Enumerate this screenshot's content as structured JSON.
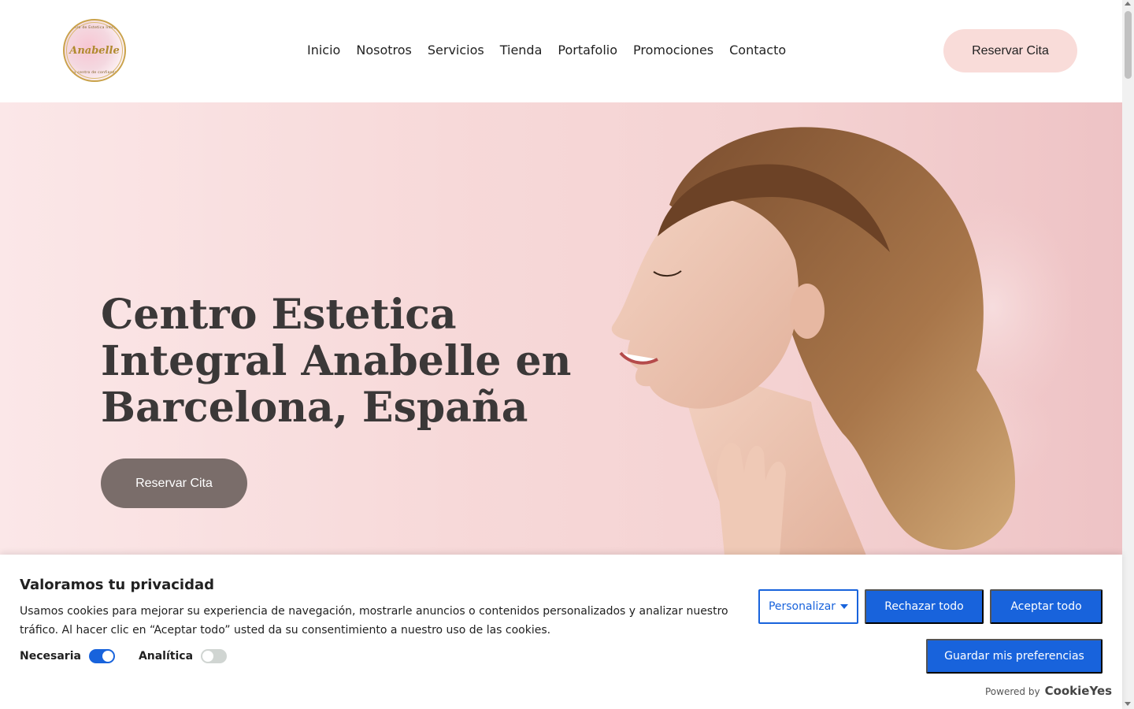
{
  "header": {
    "logo_top_text": "Centro de Estetica Integral",
    "logo_text": "Anabelle",
    "logo_bottom_text": "tu centro de confianza",
    "nav": [
      "Inicio",
      "Nosotros",
      "Servicios",
      "Tienda",
      "Portafolio",
      "Promociones",
      "Contacto"
    ],
    "cta": "Reservar Cita"
  },
  "hero": {
    "title_bold": "Centro Estetica Integral Anabelle",
    "title_rest": " en Barcelona, España",
    "cta": "Reservar Cita"
  },
  "cookie": {
    "title": "Valoramos tu privacidad",
    "description": "Usamos cookies para mejorar su experiencia de navegación, mostrarle anuncios o contenidos personalizados y analizar nuestro tráfico. Al hacer clic en “Aceptar todo” usted da su consentimiento a nuestro uso de las cookies.",
    "toggles": [
      {
        "label": "Necesaria",
        "on": true
      },
      {
        "label": "Analítica",
        "on": false
      }
    ],
    "customize": "Personalizar",
    "reject": "Rechazar todo",
    "accept": "Aceptar todo",
    "save": "Guardar mis preferencias",
    "powered_by": "Powered by",
    "brand": "CookieYes"
  },
  "colors": {
    "accent": "#1863dc",
    "header_cta_bg": "#f9dcd9",
    "hero_cta_bg": "#7a6d6a",
    "title_color": "#3b3838"
  }
}
